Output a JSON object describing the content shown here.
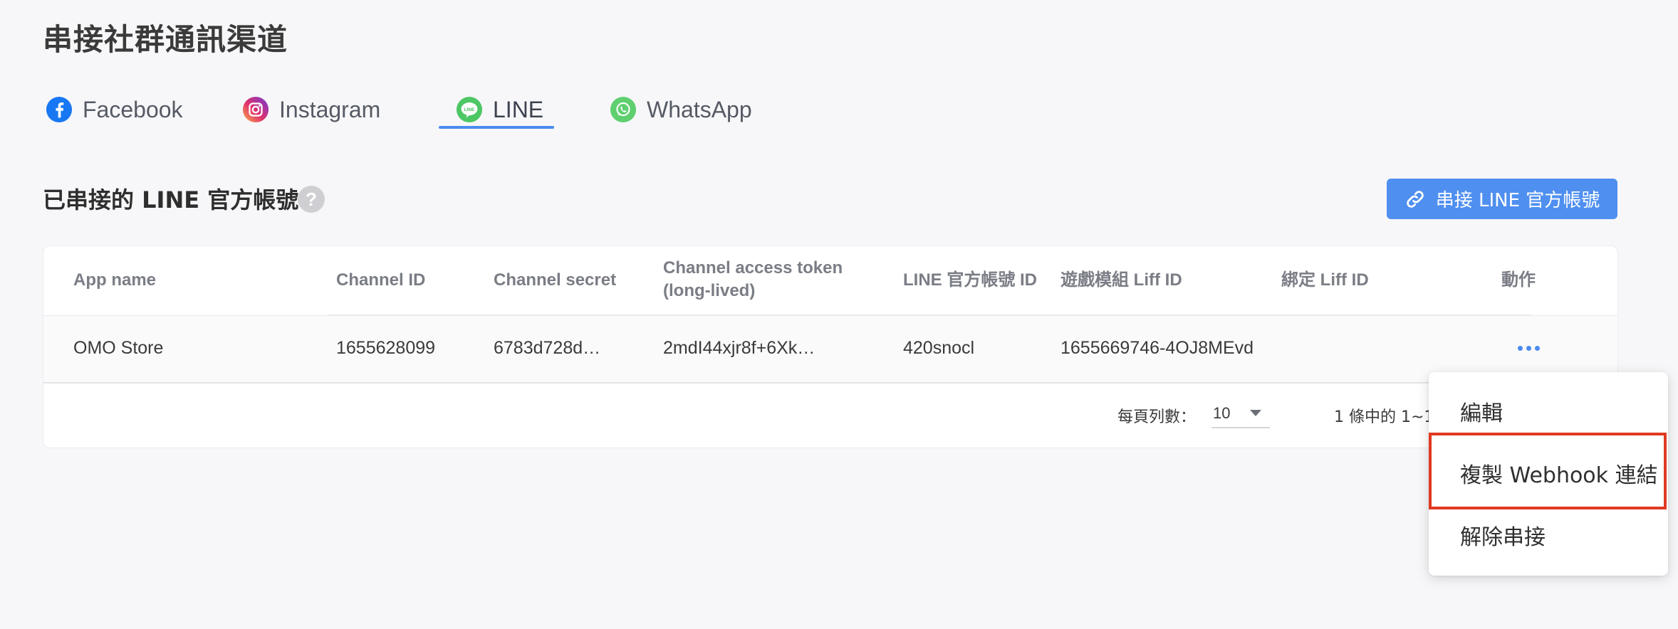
{
  "page": {
    "title": "串接社群通訊渠道"
  },
  "tabs": [
    {
      "label": "Facebook",
      "icon": "facebook-icon",
      "color": "#1877f2"
    },
    {
      "label": "Instagram",
      "icon": "instagram-icon",
      "color": "#e1306c"
    },
    {
      "label": "LINE",
      "icon": "line-icon",
      "color": "#4cc764",
      "active": true
    },
    {
      "label": "WhatsApp",
      "icon": "whatsapp-icon",
      "color": "#5fcf6f"
    }
  ],
  "section": {
    "title": "已串接的 LINE 官方帳號",
    "help_icon": "?",
    "connect_button": "串接 LINE 官方帳號"
  },
  "table": {
    "columns": [
      {
        "label": "App name"
      },
      {
        "label": "Channel ID"
      },
      {
        "label": "Channel secret"
      },
      {
        "label": "Channel access token",
        "label2": "(long-lived)"
      },
      {
        "label": "LINE 官方帳號 ID"
      },
      {
        "label": "遊戲模組 Liff ID"
      },
      {
        "label": "綁定 Liff ID"
      },
      {
        "label": "動作"
      }
    ],
    "rows": [
      {
        "app_name": "OMO Store",
        "channel_id": "1655628099",
        "channel_secret": "6783d728d…",
        "access_token": "2mdI44xjr8f+6Xk…",
        "line_id": "420snocl",
        "game_liff_id": "1655669746-4OJ8MEvd",
        "bind_liff_id": ""
      }
    ]
  },
  "pagination": {
    "rows_per_page_label": "每頁列數：",
    "rows_per_page": "10",
    "range_text": "1 條中的 1~1"
  },
  "action_menu": {
    "items": [
      {
        "label": "編輯"
      },
      {
        "label": "複製 Webhook 連結",
        "highlighted": true
      },
      {
        "label": "解除串接"
      }
    ],
    "highlight_color": "#e03a22"
  },
  "colors": {
    "accent": "#4a8bef",
    "button": "#4f8ff0",
    "background": "#f7f7f9"
  }
}
